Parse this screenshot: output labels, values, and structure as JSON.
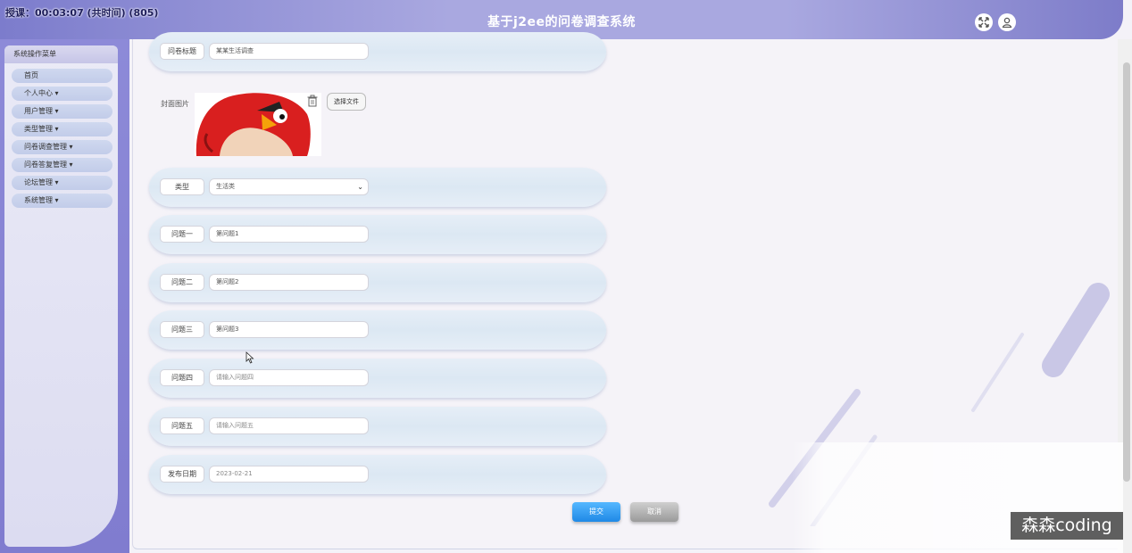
{
  "header": {
    "recording": "授课：00:03:07 (共时间) (805)",
    "title": "基于j2ee的问卷调查系统"
  },
  "sidebar": {
    "title": "系统操作菜单",
    "items": [
      {
        "label": "首页"
      },
      {
        "label": "个人中心 ▾"
      },
      {
        "label": "用户管理 ▾"
      },
      {
        "label": "类型管理 ▾"
      },
      {
        "label": "问卷调查管理 ▾"
      },
      {
        "label": "问卷答复管理 ▾"
      },
      {
        "label": "论坛管理 ▾"
      },
      {
        "label": "系统管理 ▾"
      }
    ]
  },
  "form": {
    "title_row": {
      "label": "问卷标题",
      "value": "某某生活调查"
    },
    "cover": {
      "label": "封面图片",
      "choose_label": "选择文件"
    },
    "type_row": {
      "label": "类型",
      "value": "生活类"
    },
    "q1": {
      "label": "问题一",
      "value": "第问题1"
    },
    "q2": {
      "label": "问题二",
      "value": "第问题2"
    },
    "q3": {
      "label": "问题三",
      "value": "第问题3"
    },
    "q4": {
      "label": "问题四",
      "placeholder": "请输入问题四"
    },
    "q5": {
      "label": "问题五",
      "placeholder": "请输入问题五"
    },
    "date_row": {
      "label": "发布日期",
      "value": "2023-02-21"
    }
  },
  "buttons": {
    "submit": "提交",
    "cancel": "取消"
  },
  "watermark": "森森coding",
  "colors": {
    "header_accent": "#9b99dc",
    "submit": "#2a94ef",
    "cancel": "#a9a9a9"
  }
}
